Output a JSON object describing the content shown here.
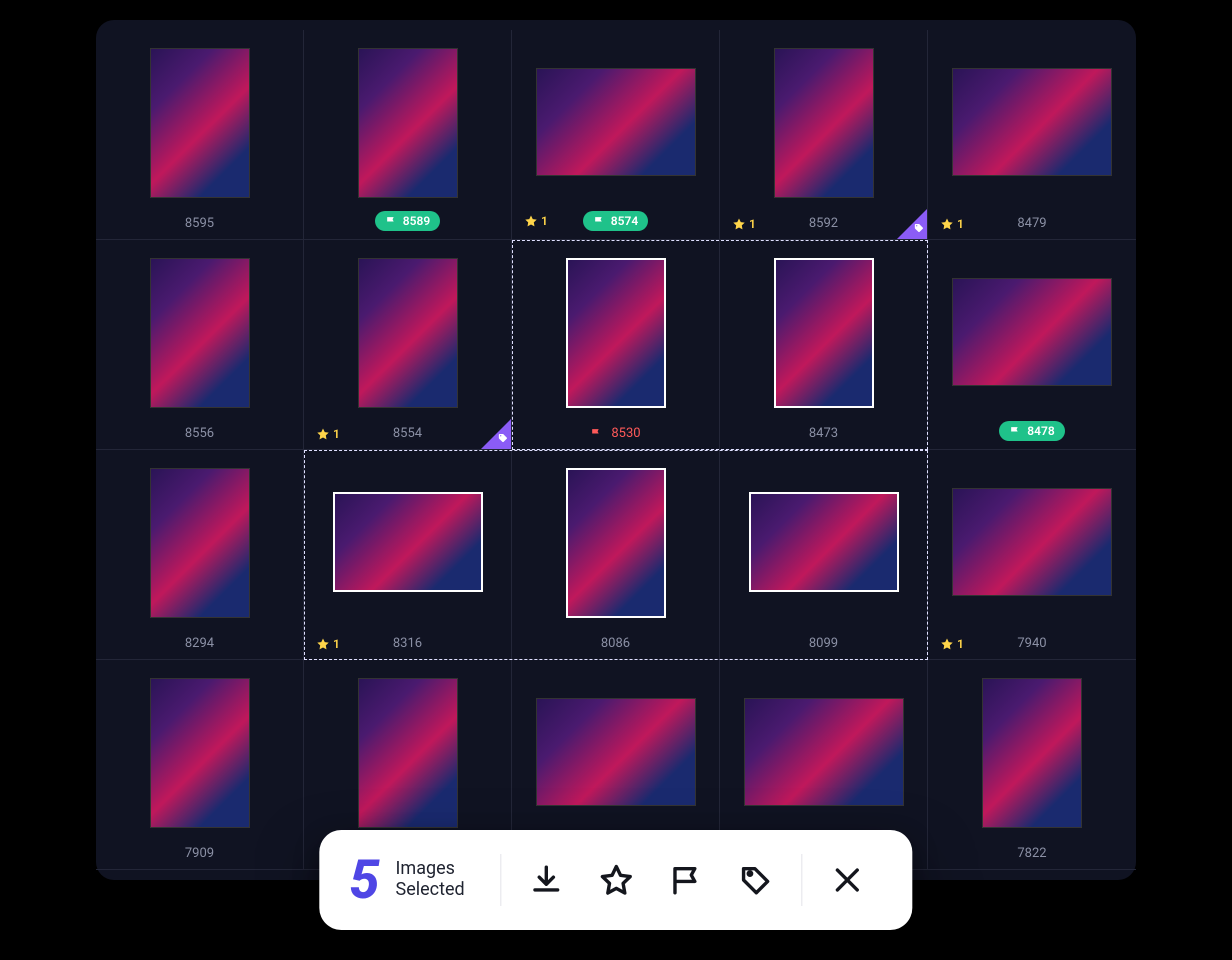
{
  "grid": [
    {
      "id": "8595",
      "orient": "portrait",
      "selected": false,
      "star": null,
      "flag": null,
      "pill": false,
      "tag": false
    },
    {
      "id": "8589",
      "orient": "portrait",
      "selected": false,
      "star": null,
      "flag": "white",
      "pill": true,
      "tag": false
    },
    {
      "id": "8574",
      "orient": "landscape",
      "selected": false,
      "star": "1",
      "flag": "white",
      "pill": true,
      "tag": false
    },
    {
      "id": "8592",
      "orient": "portrait",
      "selected": false,
      "star": "1",
      "flag": null,
      "pill": false,
      "tag": true
    },
    {
      "id": "8479",
      "orient": "landscape",
      "selected": false,
      "star": "1",
      "flag": null,
      "pill": false,
      "tag": false
    },
    {
      "id": "8556",
      "orient": "portrait",
      "selected": false,
      "star": null,
      "flag": null,
      "pill": false,
      "tag": false
    },
    {
      "id": "8554",
      "orient": "portrait",
      "selected": false,
      "star": "1",
      "flag": null,
      "pill": false,
      "tag": true
    },
    {
      "id": "8530",
      "orient": "portrait",
      "selected": true,
      "star": null,
      "flag": "red",
      "pill": false,
      "tag": false
    },
    {
      "id": "8473",
      "orient": "portrait",
      "selected": true,
      "star": null,
      "flag": null,
      "pill": false,
      "tag": false
    },
    {
      "id": "8478",
      "orient": "landscape",
      "selected": false,
      "star": null,
      "flag": "white",
      "pill": true,
      "tag": false
    },
    {
      "id": "8294",
      "orient": "portrait",
      "selected": false,
      "star": null,
      "flag": null,
      "pill": false,
      "tag": false
    },
    {
      "id": "8316",
      "orient": "landscape2",
      "selected": true,
      "star": "1",
      "flag": null,
      "pill": false,
      "tag": false
    },
    {
      "id": "8086",
      "orient": "portrait",
      "selected": true,
      "star": null,
      "flag": null,
      "pill": false,
      "tag": false
    },
    {
      "id": "8099",
      "orient": "landscape2",
      "selected": true,
      "star": null,
      "flag": null,
      "pill": false,
      "tag": false
    },
    {
      "id": "7940",
      "orient": "landscape",
      "selected": false,
      "star": "1",
      "flag": null,
      "pill": false,
      "tag": false
    },
    {
      "id": "7909",
      "orient": "portrait",
      "selected": false,
      "star": null,
      "flag": null,
      "pill": false,
      "tag": false
    },
    {
      "id": "",
      "orient": "portrait",
      "selected": false,
      "star": null,
      "flag": null,
      "pill": false,
      "tag": false
    },
    {
      "id": "",
      "orient": "landscape",
      "selected": false,
      "star": null,
      "flag": null,
      "pill": false,
      "tag": false
    },
    {
      "id": "",
      "orient": "landscape",
      "selected": false,
      "star": null,
      "flag": null,
      "pill": false,
      "tag": false
    },
    {
      "id": "7822",
      "orient": "portrait",
      "selected": false,
      "star": null,
      "flag": null,
      "pill": false,
      "tag": false
    }
  ],
  "actionbar": {
    "count": "5",
    "line1": "Images",
    "line2": "Selected",
    "download": "Download",
    "star": "Rate",
    "flag": "Flag",
    "tag": "Tag",
    "close": "Close"
  }
}
